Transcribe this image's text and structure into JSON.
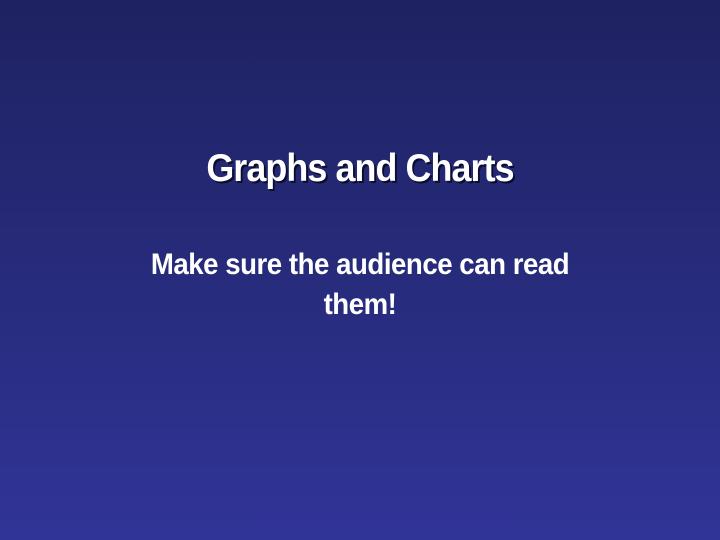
{
  "slide": {
    "title": "Graphs and Charts",
    "body": "Make sure the audience can read them!",
    "background_top_color": "#1e2262",
    "background_bottom_color": "#313497",
    "text_color": "#ffffff"
  }
}
